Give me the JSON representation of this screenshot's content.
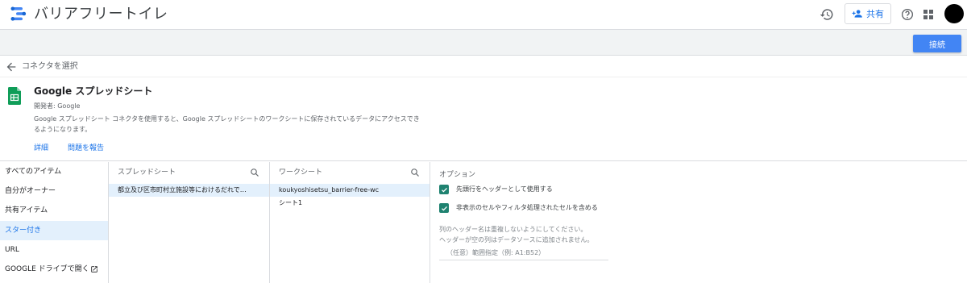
{
  "app": {
    "title": "バリアフリートイレ",
    "share_label": "共有"
  },
  "toolbar": {
    "connect_label": "接続"
  },
  "breadcrumb": {
    "label": "コネクタを選択"
  },
  "connector": {
    "name": "Google スプレッドシート",
    "developer": "開発者: Google",
    "description_line1": "Google スプレッドシート コネクタを使用すると、Google スプレッドシートのワークシートに保存されているデータにアクセスでき",
    "description_line2": "るようになります。",
    "details_link": "詳細",
    "report_link": "問題を報告"
  },
  "sidebar": {
    "items": [
      {
        "label": "すべてのアイテム",
        "active": false
      },
      {
        "label": "自分がオーナー",
        "active": false
      },
      {
        "label": "共有アイテム",
        "active": false
      },
      {
        "label": "スター付き",
        "active": true
      },
      {
        "label": "URL",
        "active": false
      },
      {
        "label": "GOOGLE ドライブで開く",
        "active": false
      }
    ]
  },
  "spreadsheet_col": {
    "header": "スプレッドシート",
    "rows": [
      "都立及び区市町村立施設等におけるだれで…"
    ]
  },
  "worksheet_col": {
    "header": "ワークシート",
    "rows": [
      "koukyoshisetsu_barrier-free-wc",
      "シート1"
    ]
  },
  "options": {
    "header": "オプション",
    "checkbox1": "先頭行をヘッダーとして使用する",
    "checkbox2": "非表示のセルやフィルタ処理されたセルを含める",
    "note_line1": "列のヘッダー名は重複しないようにしてください。",
    "note_line2": "ヘッダーが空の列はデータソースに追加されません。",
    "range_placeholder": "（任意）範囲指定（例: A1:B52）"
  },
  "colors": {
    "accent": "#1a73e8",
    "primary_button": "#4285f4",
    "checkbox": "#1f8270",
    "selection": "#e3f0fc"
  }
}
